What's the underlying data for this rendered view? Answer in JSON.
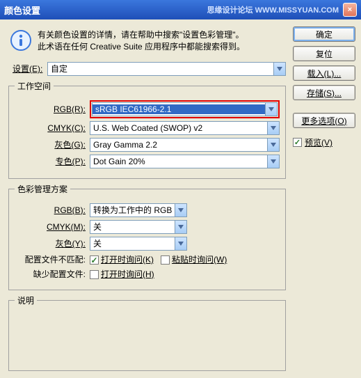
{
  "titlebar": {
    "title": "颜色设置",
    "watermark": "思缘设计论坛 WWW.MISSYUAN.COM"
  },
  "info": {
    "line1": "有关颜色设置的详情，请在帮助中搜索\"设置色彩管理\"。",
    "line2": "此术语在任何 Creative Suite 应用程序中都能搜索得到。"
  },
  "settings": {
    "label": "设置(E):",
    "value": "自定"
  },
  "workspace": {
    "legend": "工作空间",
    "rgb_label": "RGB(R):",
    "rgb_value": "sRGB IEC61966-2.1",
    "cmyk_label": "CMYK(C):",
    "cmyk_value": "U.S. Web Coated (SWOP) v2",
    "gray_label": "灰色(G):",
    "gray_value": "Gray Gamma 2.2",
    "spot_label": "专色(P):",
    "spot_value": "Dot Gain 20%"
  },
  "policy": {
    "legend": "色彩管理方案",
    "rgb_label": "RGB(B):",
    "rgb_value": "转换为工作中的 RGB",
    "cmyk_label": "CMYK(M):",
    "cmyk_value": "关",
    "gray_label": "灰色(Y):",
    "gray_value": "关",
    "mismatch_label": "配置文件不匹配:",
    "mismatch_open": "打开时询问(K)",
    "mismatch_paste": "粘贴时询问(W)",
    "missing_label": "缺少配置文件:",
    "missing_open": "打开时询问(H)"
  },
  "description": {
    "legend": "说明"
  },
  "buttons": {
    "ok": "确定",
    "reset": "复位",
    "load": "载入(L)...",
    "save": "存储(S)...",
    "more": "更多选项(O)",
    "preview": "预览(V)"
  }
}
